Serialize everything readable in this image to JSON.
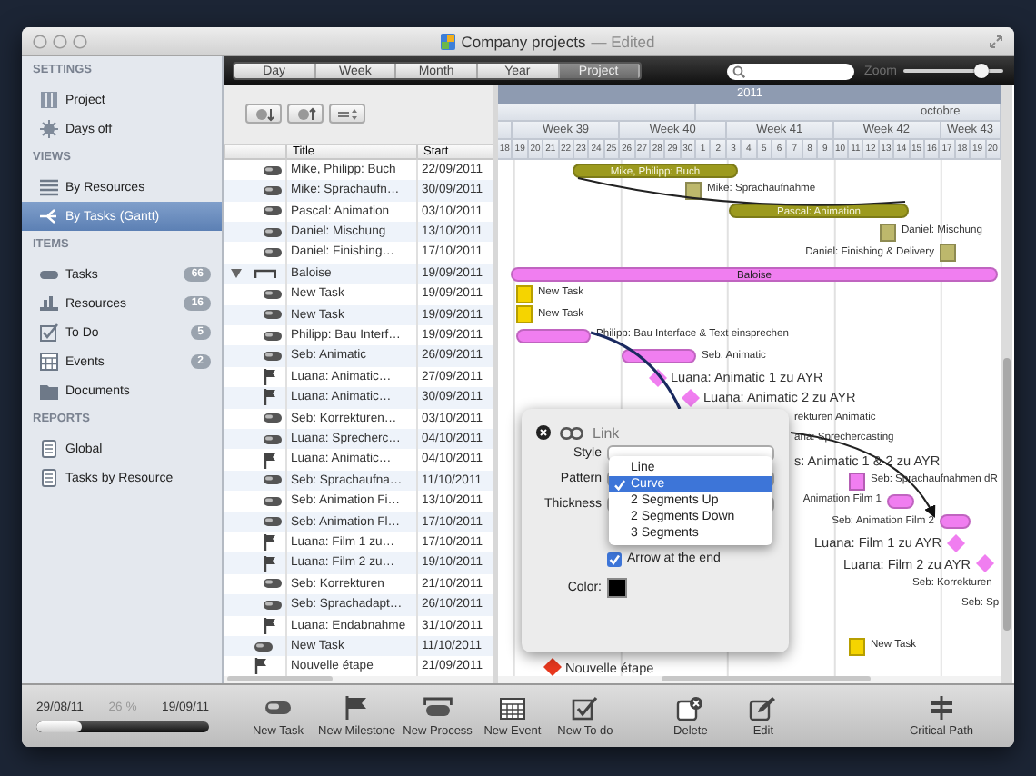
{
  "window": {
    "title": "Company projects",
    "status": "— Edited"
  },
  "view_switcher": [
    {
      "label": "Day",
      "selected": false
    },
    {
      "label": "Week",
      "selected": false
    },
    {
      "label": "Month",
      "selected": false
    },
    {
      "label": "Year",
      "selected": false
    },
    {
      "label": "Project",
      "selected": true
    }
  ],
  "zoom": {
    "label": "Zoom",
    "level": 0.78
  },
  "sidebar": {
    "sections": [
      {
        "heading": "SETTINGS",
        "items": [
          {
            "kind": "project",
            "label": "Project",
            "selected": false
          },
          {
            "kind": "days_off",
            "label": "Days off",
            "selected": false
          }
        ]
      },
      {
        "heading": "VIEWS",
        "items": [
          {
            "kind": "by_resources",
            "label": "By Resources",
            "selected": false
          },
          {
            "kind": "gantt",
            "label": "By Tasks (Gantt)",
            "selected": true
          }
        ]
      },
      {
        "heading": "ITEMS",
        "items": [
          {
            "kind": "tasks",
            "label": "Tasks",
            "count": "66",
            "selected": false
          },
          {
            "kind": "resources",
            "label": "Resources",
            "count": "16",
            "selected": false
          },
          {
            "kind": "todo",
            "label": "To Do",
            "count": "5",
            "selected": false
          },
          {
            "kind": "events",
            "label": "Events",
            "count": "2",
            "selected": false
          },
          {
            "kind": "documents",
            "label": "Documents",
            "selected": false
          }
        ]
      },
      {
        "heading": "REPORTS",
        "items": [
          {
            "kind": "report",
            "label": "Global",
            "selected": false
          },
          {
            "kind": "report",
            "label": "Tasks by Resource",
            "selected": false
          }
        ]
      }
    ]
  },
  "task_table": {
    "columns": [
      "Title",
      "Start"
    ],
    "rows": [
      {
        "kind": "hidden_parent",
        "children": [
          {
            "kind": "task",
            "title": "Mike, Philipp: Buch",
            "start": "22/09/2011"
          },
          {
            "kind": "task",
            "title": "Mike: Sprachaufn…",
            "start": "30/09/2011"
          },
          {
            "kind": "task",
            "title": "Pascal: Animation",
            "start": "03/10/2011"
          },
          {
            "kind": "task",
            "title": "Daniel: Mischung",
            "start": "13/10/2011"
          },
          {
            "kind": "task",
            "title": "Daniel: Finishing…",
            "start": "17/10/2011"
          }
        ]
      },
      {
        "kind": "process",
        "title": "Baloise",
        "start": "19/09/2011",
        "expanded": true,
        "children": [
          {
            "kind": "task",
            "title": "New Task",
            "start": "19/09/2011"
          },
          {
            "kind": "task",
            "title": "New Task",
            "start": "19/09/2011"
          },
          {
            "kind": "task",
            "title": "Philipp: Bau Interf…",
            "start": "19/09/2011"
          },
          {
            "kind": "task",
            "title": "Seb: Animatic",
            "start": "26/09/2011"
          },
          {
            "kind": "milestone",
            "title": "Luana: Animatic…",
            "start": "27/09/2011"
          },
          {
            "kind": "milestone",
            "title": "Luana: Animatic…",
            "start": "30/09/2011"
          },
          {
            "kind": "task",
            "title": "Seb: Korrekturen…",
            "start": "03/10/2011"
          },
          {
            "kind": "task",
            "title": "Luana: Sprecherc…",
            "start": "04/10/2011"
          },
          {
            "kind": "milestone",
            "title": "Luana: Animatic…",
            "start": "04/10/2011"
          },
          {
            "kind": "task",
            "title": "Seb: Sprachaufna…",
            "start": "11/10/2011"
          },
          {
            "kind": "task",
            "title": "Seb: Animation Fi…",
            "start": "13/10/2011"
          },
          {
            "kind": "task",
            "title": "Seb: Animation Fl…",
            "start": "17/10/2011"
          },
          {
            "kind": "milestone",
            "title": "Luana: Film 1 zu…",
            "start": "17/10/2011"
          },
          {
            "kind": "milestone",
            "title": "Luana: Film 2 zu…",
            "start": "19/10/2011"
          },
          {
            "kind": "task",
            "title": "Seb: Korrekturen",
            "start": "21/10/2011"
          },
          {
            "kind": "task",
            "title": "Seb: Sprachadapt…",
            "start": "26/10/2011"
          },
          {
            "kind": "milestone",
            "title": "Luana: Endabnahme",
            "start": "31/10/2011"
          }
        ]
      },
      {
        "kind": "task",
        "title": "New Task",
        "start": "11/10/2011"
      },
      {
        "kind": "milestone",
        "title": "Nouvelle étape",
        "start": "21/09/2011"
      }
    ]
  },
  "gantt": {
    "year": "2011",
    "month": "octobre",
    "weeks": [
      "Week 39",
      "Week 40",
      "Week 41",
      "Week 42",
      "Week 43"
    ],
    "days": [
      "18",
      "19",
      "20",
      "21",
      "22",
      "23",
      "24",
      "25",
      "26",
      "27",
      "28",
      "29",
      "30",
      "1",
      "2",
      "3",
      "4",
      "5",
      "6",
      "7",
      "8",
      "9",
      "10",
      "11",
      "12",
      "13",
      "14",
      "15",
      "16",
      "17",
      "18",
      "19",
      "20"
    ],
    "items": [
      {
        "kind": "bar",
        "label": "Mike, Philipp: Buch",
        "color": "#9c9a1e"
      },
      {
        "kind": "square",
        "label": "Mike: Sprachaufnahme",
        "color": "#bdb86c"
      },
      {
        "kind": "bar",
        "label": "Pascal: Animation",
        "color": "#9c9a1e"
      },
      {
        "kind": "square",
        "label": "Daniel: Mischung",
        "color": "#bdb86c"
      },
      {
        "kind": "square",
        "label": "Daniel: Finishing & Delivery",
        "color": "#bdb86c"
      },
      {
        "kind": "bar",
        "label": "Baloise",
        "color": "#f07ef0"
      },
      {
        "kind": "square",
        "label": "New Task",
        "color": "#f5d400"
      },
      {
        "kind": "square",
        "label": "New Task",
        "color": "#f5d400"
      },
      {
        "kind": "bar",
        "label": "Philipp: Bau Interface & Text einsprechen",
        "color": "#f07ef0"
      },
      {
        "kind": "bar",
        "label": "Seb: Animatic",
        "color": "#f07ef0"
      },
      {
        "kind": "diamond",
        "label": "Luana: Animatic 1 zu AYR",
        "color": "#f07ef0"
      },
      {
        "kind": "diamond",
        "label": "Luana: Animatic 2 zu AYR",
        "color": "#f07ef0"
      },
      {
        "kind": "text",
        "label": "rekturen Animatic"
      },
      {
        "kind": "text",
        "label": "ana: Sprechercasting"
      },
      {
        "kind": "text",
        "label": "s: Animatic 1 & 2 zu AYR"
      },
      {
        "kind": "square",
        "label": "Seb: Sprachaufnahmen dR",
        "color": "#f07ef0"
      },
      {
        "kind": "bar",
        "label": "Animation Film 1",
        "color": "#f07ef0"
      },
      {
        "kind": "bar",
        "label": "Seb: Animation Film 2",
        "color": "#f07ef0"
      },
      {
        "kind": "diamond",
        "label": "Luana: Film 1 zu AYR",
        "color": "#f07ef0"
      },
      {
        "kind": "diamond",
        "label": "Luana: Film 2 zu AYR",
        "color": "#f07ef0"
      },
      {
        "kind": "text",
        "label": "Seb: Korrekturen"
      },
      {
        "kind": "text",
        "label": "Seb: Sp"
      },
      {
        "kind": "square",
        "label": "New Task",
        "color": "#f5d400"
      },
      {
        "kind": "diamond",
        "label": "Nouvelle étape",
        "color": "#e8381e"
      }
    ]
  },
  "link_dialog": {
    "title": "Link",
    "fields": [
      "Style",
      "Pattern",
      "Thickness"
    ],
    "menu": [
      {
        "label": "Line",
        "selected": false
      },
      {
        "label": "Curve",
        "selected": true
      },
      {
        "label": "2 Segments Up",
        "selected": false
      },
      {
        "label": "2 Segments Down",
        "selected": false
      },
      {
        "label": "3 Segments",
        "selected": false
      }
    ],
    "arrow_at_end": {
      "label": "Arrow at the end",
      "checked": true
    },
    "color_label": "Color:",
    "color": "#000000"
  },
  "progress": {
    "start": "29/08/11",
    "percent": "26 %",
    "end": "19/09/11",
    "level": 0.26
  },
  "toolbar": [
    {
      "kind": "new_task",
      "label": "New Task"
    },
    {
      "kind": "new_milestone",
      "label": "New Milestone"
    },
    {
      "kind": "new_process",
      "label": "New Process"
    },
    {
      "kind": "new_event",
      "label": "New Event"
    },
    {
      "kind": "new_todo",
      "label": "New To do"
    },
    {
      "kind": "delete",
      "label": "Delete"
    },
    {
      "kind": "edit",
      "label": "Edit"
    },
    {
      "kind": "critical_path",
      "label": "Critical Path"
    }
  ]
}
